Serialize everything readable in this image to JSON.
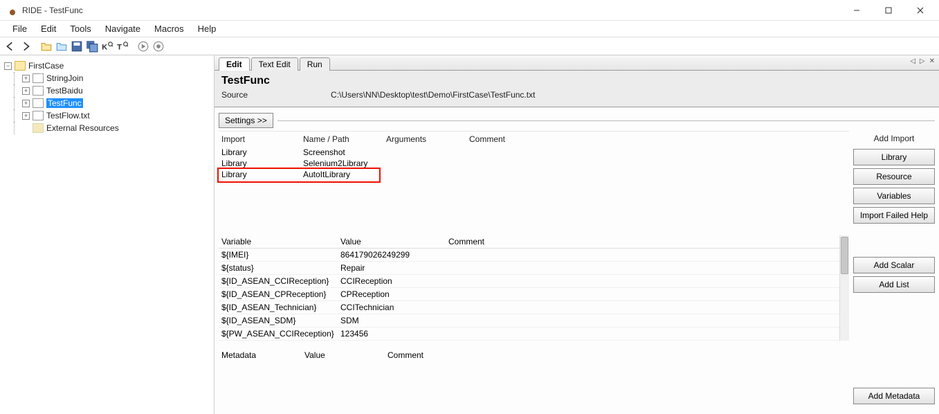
{
  "window": {
    "title": "RIDE - TestFunc"
  },
  "menus": [
    "File",
    "Edit",
    "Tools",
    "Navigate",
    "Macros",
    "Help"
  ],
  "toolbar_icons": [
    "back-icon",
    "forward-icon",
    "sep",
    "open-folder-icon",
    "open-suite-icon",
    "save-icon",
    "save-all-icon",
    "keyword-search-icon",
    "test-search-icon",
    "sep",
    "run-icon",
    "stop-icon"
  ],
  "tree": {
    "root": {
      "label": "FirstCase",
      "expanded": true
    },
    "children": [
      {
        "label": "StringJoin",
        "type": "file",
        "expandable": true
      },
      {
        "label": "TestBaidu",
        "type": "file",
        "expandable": true
      },
      {
        "label": "TestFunc",
        "type": "file",
        "selected": true,
        "expandable": true
      },
      {
        "label": "TestFlow.txt",
        "type": "file",
        "expandable": true
      }
    ],
    "external": {
      "label": "External Resources"
    }
  },
  "tabs": {
    "items": [
      "Edit",
      "Text Edit",
      "Run"
    ],
    "active": 0,
    "tools": [
      "◁",
      "▷",
      "✕"
    ]
  },
  "header": {
    "title": "TestFunc",
    "source_label": "Source",
    "source_path": "C:\\Users\\NN\\Desktop\\test\\Demo\\FirstCase\\TestFunc.txt"
  },
  "settings_button": "Settings >>",
  "imports": {
    "headers": {
      "import": "Import",
      "name": "Name / Path",
      "args": "Arguments",
      "comment": "Comment"
    },
    "rows": [
      {
        "import": "Library",
        "name": "Screenshot",
        "args": "",
        "comment": ""
      },
      {
        "import": "Library",
        "name": "Selenium2Library",
        "args": "",
        "comment": ""
      },
      {
        "import": "Library",
        "name": "AutoItLibrary",
        "args": "",
        "comment": "",
        "highlighted": true
      }
    ]
  },
  "sidebar": {
    "add_import_label": "Add Import",
    "import_buttons": [
      "Library",
      "Resource",
      "Variables",
      "Import Failed Help"
    ],
    "var_buttons": [
      "Add Scalar",
      "Add List"
    ],
    "meta_button": "Add Metadata"
  },
  "variables": {
    "headers": {
      "variable": "Variable",
      "value": "Value",
      "comment": "Comment"
    },
    "rows": [
      {
        "variable": "${IMEI}",
        "value": "864179026249299",
        "comment": ""
      },
      {
        "variable": "${status}",
        "value": "Repair",
        "comment": ""
      },
      {
        "variable": "${ID_ASEAN_CCIReception}",
        "value": "CCIReception",
        "comment": ""
      },
      {
        "variable": "${ID_ASEAN_CPReception}",
        "value": "CPReception",
        "comment": ""
      },
      {
        "variable": "${ID_ASEAN_Technician}",
        "value": "CCITechnician",
        "comment": ""
      },
      {
        "variable": "${ID_ASEAN_SDM}",
        "value": "SDM",
        "comment": ""
      },
      {
        "variable": "${PW_ASEAN_CCIReception}",
        "value": "123456",
        "comment": ""
      }
    ]
  },
  "metadata": {
    "headers": {
      "metadata": "Metadata",
      "value": "Value",
      "comment": "Comment"
    }
  }
}
